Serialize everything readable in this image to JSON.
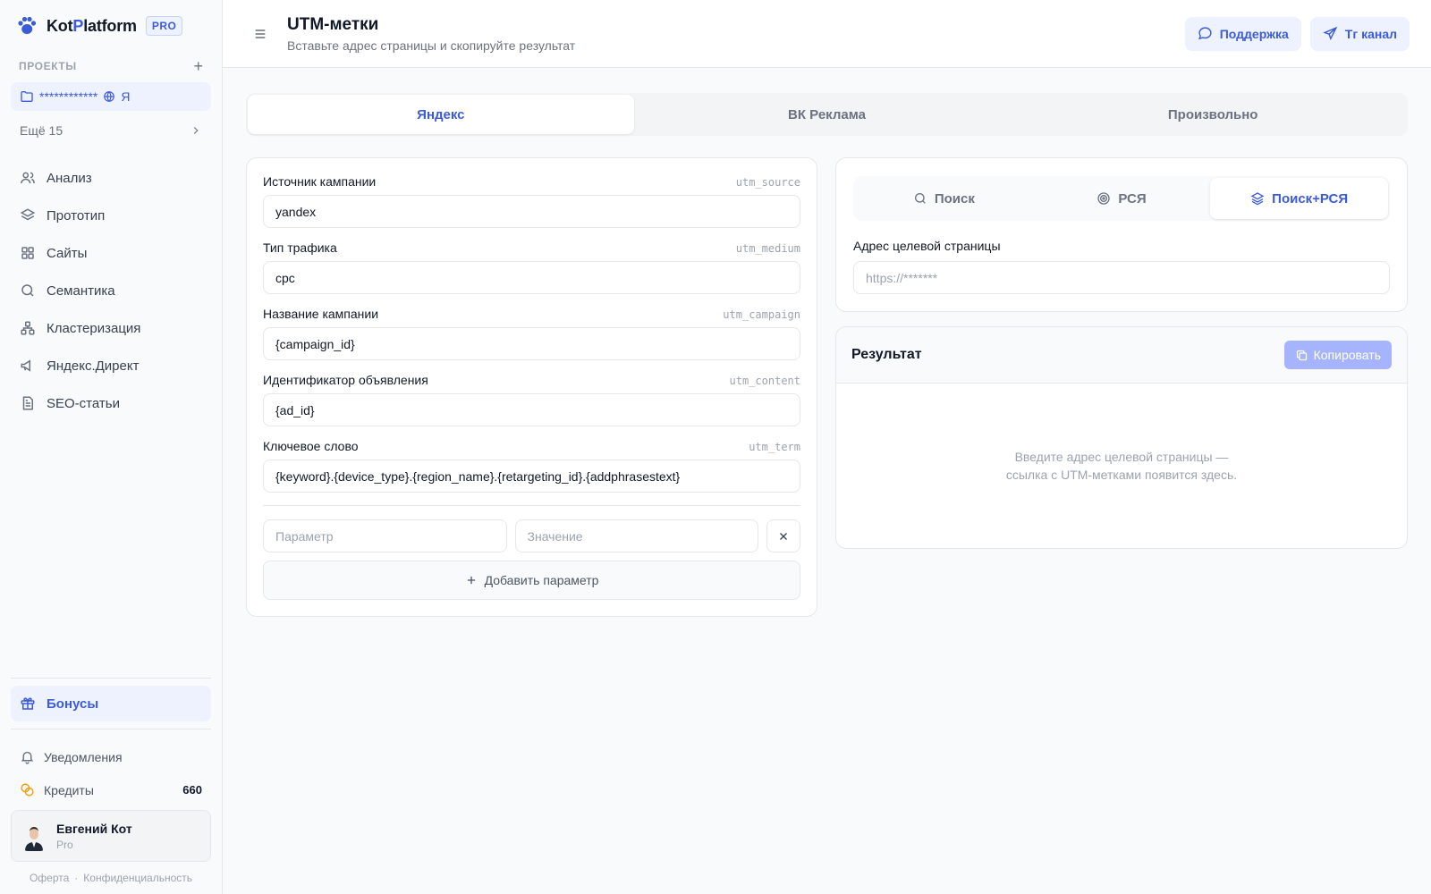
{
  "brand": {
    "name_a": "Kot",
    "name_p": "P",
    "name_b": "latform",
    "badge": "PRO"
  },
  "sidebar": {
    "projects_title": "ПРОЕКТЫ",
    "project_name": "************",
    "project_suffix": "Я",
    "more_label": "Ещё 15",
    "nav": [
      {
        "label": "Анализ",
        "icon": "users-icon"
      },
      {
        "label": "Прототип",
        "icon": "layers-icon"
      },
      {
        "label": "Сайты",
        "icon": "grid-icon"
      },
      {
        "label": "Семантика",
        "icon": "search-icon"
      },
      {
        "label": "Кластеризация",
        "icon": "cluster-icon"
      },
      {
        "label": "Яндекс.Директ",
        "icon": "megaphone-icon"
      },
      {
        "label": "SEO-статьи",
        "icon": "document-icon"
      }
    ],
    "bonus_label": "Бонусы",
    "notifications_label": "Уведомления",
    "credits_label": "Кредиты",
    "credits_value": "660",
    "user_name": "Евгений Кот",
    "user_plan": "Pro",
    "footer_offer": "Оферта",
    "footer_dot": "·",
    "footer_privacy": "Конфиденциальность"
  },
  "header": {
    "title": "UTM-метки",
    "subtitle": "Вставьте адрес страницы и скопируйте результат",
    "support_label": "Поддержка",
    "tg_label": "Tг канал"
  },
  "tabs": [
    "Яндекс",
    "ВК Реклама",
    "Произвольно"
  ],
  "form": {
    "fields": [
      {
        "label": "Источник кампании",
        "code": "utm_source",
        "value": "yandex"
      },
      {
        "label": "Тип трафика",
        "code": "utm_medium",
        "value": "cpc"
      },
      {
        "label": "Название кампании",
        "code": "utm_campaign",
        "value": "{campaign_id}"
      },
      {
        "label": "Идентификатор объявления",
        "code": "utm_content",
        "value": "{ad_id}"
      },
      {
        "label": "Ключевое слово",
        "code": "utm_term",
        "value": "{keyword}.{device_type}.{region_name}.{retargeting_id}.{addphrasestext}"
      }
    ],
    "param_placeholder": "Параметр",
    "value_placeholder": "Значение",
    "add_param_label": "Добавить параметр"
  },
  "target": {
    "subtabs": [
      "Поиск",
      "РСЯ",
      "Поиск+РСЯ"
    ],
    "label": "Адрес целевой страницы",
    "placeholder": "https://*******"
  },
  "result": {
    "title": "Результат",
    "copy_label": "Копировать",
    "empty_line1": "Введите адрес целевой страницы —",
    "empty_line2": "ссылка с UTM-метками появится здесь."
  },
  "colors": {
    "accent": "#3b5bdb",
    "accent_bg": "#eef2ff",
    "copy_disabled": "#a5b4fc"
  }
}
